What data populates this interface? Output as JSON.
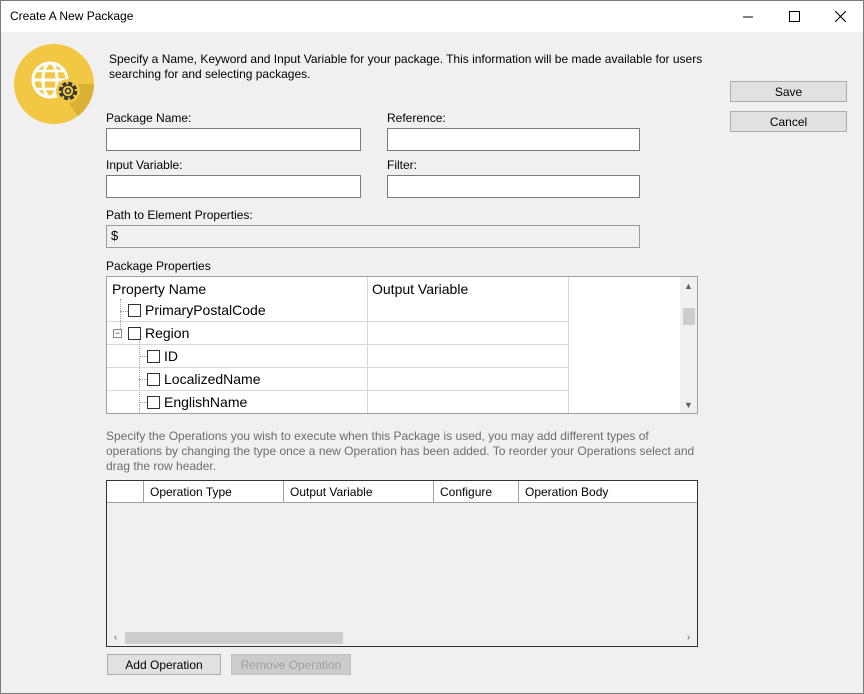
{
  "window": {
    "title": "Create A New Package"
  },
  "header": {
    "description": "Specify a Name, Keyword and Input Variable for your package. This information will be made available for users searching for and selecting packages."
  },
  "buttons": {
    "save": "Save",
    "cancel": "Cancel",
    "add_operation": "Add Operation",
    "remove_operation": "Remove Operation"
  },
  "fields": {
    "package_name": {
      "label": "Package Name:",
      "value": ""
    },
    "reference": {
      "label": "Reference:",
      "value": ""
    },
    "input_variable": {
      "label": "Input Variable:",
      "value": ""
    },
    "filter": {
      "label": "Filter:",
      "value": ""
    },
    "path": {
      "label": "Path to Element Properties:",
      "value": "$"
    }
  },
  "package_properties": {
    "label": "Package Properties",
    "columns": [
      "Property Name",
      "Output Variable"
    ],
    "rows": [
      {
        "name": "PrimaryPostalCode",
        "output": ""
      },
      {
        "name": "Region",
        "output": "",
        "expanded": true
      },
      {
        "name": "ID",
        "output": ""
      },
      {
        "name": "LocalizedName",
        "output": ""
      },
      {
        "name": "EnglishName",
        "output": ""
      }
    ]
  },
  "operations": {
    "description": "Specify the Operations you wish to execute when this Package is used, you may add different types of operations by changing the type once a new Operation has been added. To reorder your Operations select and drag the row header.",
    "columns": [
      "Operation Type",
      "Output Variable",
      "Configure",
      "Operation Body"
    ]
  },
  "icons": {
    "logo": "globe-gear-icon",
    "minimize": "minimize-icon",
    "maximize": "maximize-icon",
    "close": "close-icon"
  },
  "colors": {
    "logo_circle": "#F2C744",
    "accent_border": "#7a7a7a"
  }
}
